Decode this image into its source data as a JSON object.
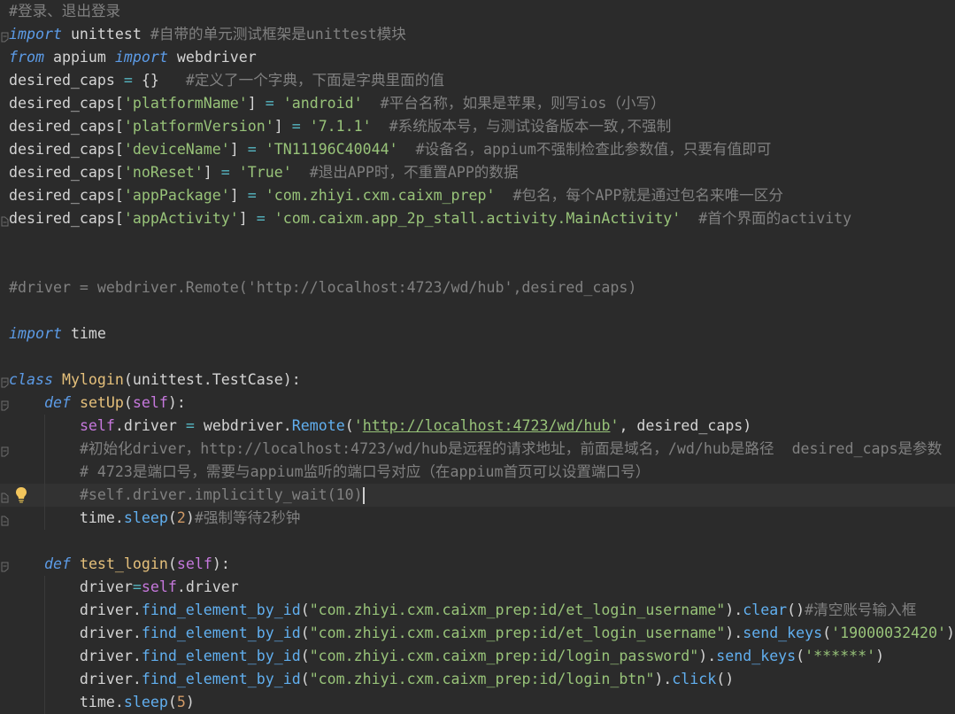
{
  "theme": {
    "background": "#2B2B2B",
    "active_line": "#323232",
    "text": "#D4D4D4",
    "comment": "#808080",
    "keyword": "#5C9BE6",
    "string": "#98C379",
    "definition": "#E5C07B",
    "self": "#C678DD",
    "function": "#61AFEF",
    "number": "#D19A66",
    "operator": "#56B6C2"
  },
  "gutter_icons": {
    "fold": "fold-toggle-icon",
    "intention": "lightbulb-icon"
  },
  "code": {
    "active_line": 21,
    "lines": [
      [
        {
          "cmt": "#登录、退出登录"
        }
      ],
      [
        {
          "kw": "import"
        },
        {
          "txt": " unittest "
        },
        {
          "cmt": "#自带的单元测试框架是unittest模块"
        }
      ],
      [
        {
          "kw": "from"
        },
        {
          "txt": " appium "
        },
        {
          "kw": "import"
        },
        {
          "txt": " webdriver"
        }
      ],
      [
        {
          "txt": "desired_caps "
        },
        {
          "op": "="
        },
        {
          "txt": " {}   "
        },
        {
          "cmt": "#定义了一个字典，下面是字典里面的值"
        }
      ],
      [
        {
          "txt": "desired_caps["
        },
        {
          "str": "'platformName'"
        },
        {
          "txt": "] "
        },
        {
          "op": "="
        },
        {
          "txt": " "
        },
        {
          "str": "'android'"
        },
        {
          "txt": "  "
        },
        {
          "cmt": "#平台名称，如果是苹果，则写ios（小写）"
        }
      ],
      [
        {
          "txt": "desired_caps["
        },
        {
          "str": "'platformVersion'"
        },
        {
          "txt": "] "
        },
        {
          "op": "="
        },
        {
          "txt": " "
        },
        {
          "str": "'7.1.1'"
        },
        {
          "txt": "  "
        },
        {
          "cmt": "#系统版本号，与测试设备版本一致,不强制"
        }
      ],
      [
        {
          "txt": "desired_caps["
        },
        {
          "str": "'deviceName'"
        },
        {
          "txt": "] "
        },
        {
          "op": "="
        },
        {
          "txt": " "
        },
        {
          "str": "'TN11196C40044'"
        },
        {
          "txt": "  "
        },
        {
          "cmt": "#设备名，appium不强制检查此参数值，只要有值即可"
        }
      ],
      [
        {
          "txt": "desired_caps["
        },
        {
          "str": "'noReset'"
        },
        {
          "txt": "] "
        },
        {
          "op": "="
        },
        {
          "txt": " "
        },
        {
          "str": "'True'"
        },
        {
          "txt": "  "
        },
        {
          "cmt": "#退出APP时，不重置APP的数据"
        }
      ],
      [
        {
          "txt": "desired_caps["
        },
        {
          "str": "'appPackage'"
        },
        {
          "txt": "] "
        },
        {
          "op": "="
        },
        {
          "txt": " "
        },
        {
          "str": "'com.zhiyi.cxm.caixm_prep'"
        },
        {
          "txt": "  "
        },
        {
          "cmt": "#包名，每个APP就是通过包名来唯一区分"
        }
      ],
      [
        {
          "txt": "desired_caps["
        },
        {
          "str": "'appActivity'"
        },
        {
          "txt": "] "
        },
        {
          "op": "="
        },
        {
          "txt": " "
        },
        {
          "str": "'com.caixm.app_2p_stall.activity.MainActivity'"
        },
        {
          "txt": "  "
        },
        {
          "cmt": "#首个界面的activity"
        }
      ],
      [],
      [],
      [
        {
          "cmt": "#driver = webdriver.Remote('http://localhost:4723/wd/hub',desired_caps)"
        }
      ],
      [],
      [
        {
          "kw": "import"
        },
        {
          "txt": " time"
        }
      ],
      [],
      [
        {
          "kw": "class"
        },
        {
          "txt": " "
        },
        {
          "def": "Mylogin"
        },
        {
          "txt": "(unittest.TestCase):"
        }
      ],
      [
        {
          "txt": "    "
        },
        {
          "kw": "def"
        },
        {
          "txt": " "
        },
        {
          "def": "setUp"
        },
        {
          "txt": "("
        },
        {
          "self": "self"
        },
        {
          "txt": "):"
        }
      ],
      [
        {
          "txt": "        "
        },
        {
          "self": "self"
        },
        {
          "txt": ".driver "
        },
        {
          "op": "="
        },
        {
          "txt": " webdriver."
        },
        {
          "fn": "Remote"
        },
        {
          "txt": "("
        },
        {
          "str": "'"
        },
        {
          "url": "http://localhost:4723/wd/hub"
        },
        {
          "str": "'"
        },
        {
          "txt": ", desired_caps)"
        }
      ],
      [
        {
          "txt": "        "
        },
        {
          "cmt": "#初始化driver，http://localhost:4723/wd/hub是远程的请求地址，前面是域名，/wd/hub是路径  desired_caps是参数"
        }
      ],
      [
        {
          "txt": "        "
        },
        {
          "cmt": "# 4723是端口号，需要与appium监听的端口号对应（在appium首页可以设置端口号）"
        }
      ],
      [
        {
          "txt": "        "
        },
        {
          "cmt": "#self.driver.implicitly_wait(10)"
        }
      ],
      [
        {
          "txt": "        time."
        },
        {
          "fn": "sleep"
        },
        {
          "txt": "("
        },
        {
          "num": "2"
        },
        {
          "txt": ")"
        },
        {
          "cmt": "#强制等待2秒钟"
        }
      ],
      [],
      [
        {
          "txt": "    "
        },
        {
          "kw": "def"
        },
        {
          "txt": " "
        },
        {
          "def": "test_login"
        },
        {
          "txt": "("
        },
        {
          "self": "self"
        },
        {
          "txt": "):"
        }
      ],
      [
        {
          "txt": "        driver"
        },
        {
          "op": "="
        },
        {
          "self": "self"
        },
        {
          "txt": ".driver"
        }
      ],
      [
        {
          "txt": "        driver."
        },
        {
          "fn": "find_element_by_id"
        },
        {
          "txt": "("
        },
        {
          "str": "\"com.zhiyi.cxm.caixm_prep:id/et_login_username\""
        },
        {
          "txt": ")."
        },
        {
          "fn": "clear"
        },
        {
          "txt": "()"
        },
        {
          "cmt": "#清空账号输入框"
        }
      ],
      [
        {
          "txt": "        driver."
        },
        {
          "fn": "find_element_by_id"
        },
        {
          "txt": "("
        },
        {
          "str": "\"com.zhiyi.cxm.caixm_prep:id/et_login_username\""
        },
        {
          "txt": ")."
        },
        {
          "fn": "send_keys"
        },
        {
          "txt": "("
        },
        {
          "str": "'19000032420'"
        },
        {
          "txt": ")"
        }
      ],
      [
        {
          "txt": "        driver."
        },
        {
          "fn": "find_element_by_id"
        },
        {
          "txt": "("
        },
        {
          "str": "\"com.zhiyi.cxm.caixm_prep:id/login_password\""
        },
        {
          "txt": ")."
        },
        {
          "fn": "send_keys"
        },
        {
          "txt": "("
        },
        {
          "str": "'******'"
        },
        {
          "txt": ")"
        }
      ],
      [
        {
          "txt": "        driver."
        },
        {
          "fn": "find_element_by_id"
        },
        {
          "txt": "("
        },
        {
          "str": "\"com.zhiyi.cxm.caixm_prep:id/login_btn\""
        },
        {
          "txt": ")."
        },
        {
          "fn": "click"
        },
        {
          "txt": "()"
        }
      ],
      [
        {
          "txt": "        time."
        },
        {
          "fn": "sleep"
        },
        {
          "txt": "("
        },
        {
          "num": "5"
        },
        {
          "txt": ")"
        }
      ]
    ]
  }
}
